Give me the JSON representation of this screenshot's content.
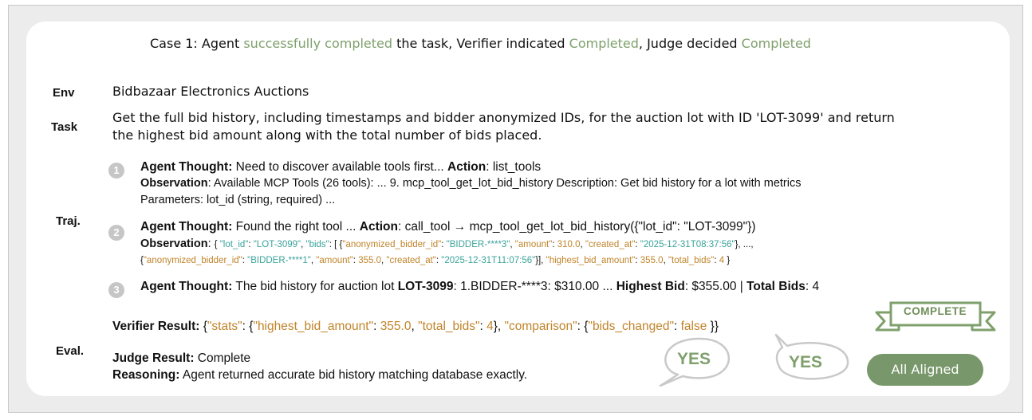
{
  "header": {
    "prefix": "Case 1: Agent ",
    "success_phrase": "successfully completed",
    "middle": " the task, Verifier indicated ",
    "verifier_word": "Completed",
    "sep": ", Judge decided ",
    "judge_word": "Completed"
  },
  "labels": {
    "env": "Env",
    "task": "Task",
    "traj": "Traj.",
    "eval": "Eval."
  },
  "env_text": "Bidbazaar Electronics Auctions",
  "task_line1": "Get the full bid history, including timestamps and bidder anonymized IDs, for the auction lot with ID 'LOT-3099' and return",
  "task_line2": "the highest bid amount along with the total number of bids placed.",
  "steps": [
    {
      "num": "1",
      "thought_label": "Agent Thought:",
      "thought": " Need to discover available tools first... ",
      "action_label": "Action",
      "action": ": list_tools",
      "obs_label": "Observation",
      "obs_line1": ": Available MCP Tools (26 tools): ... 9. mcp_tool_get_lot_bid_history Description: Get bid history for a lot with metrics",
      "obs_line2": "Parameters: lot_id (string, required) ..."
    },
    {
      "num": "2",
      "thought_label": "Agent Thought:",
      "thought": " Found the right tool ... ",
      "action_label": "Action",
      "action": ": call_tool → mcp_tool_get_lot_bid_history({\"lot_id\": \"LOT-3099\"})",
      "obs_label": "Observation",
      "obs_colon": ": ",
      "json1": {
        "p0": "{ ",
        "k0": "\"lot_id\"",
        "p1": ": ",
        "v0": "\"LOT-3099\"",
        "p2": ", ",
        "k1": "\"bids\"",
        "p3": ": [ {",
        "k2": "\"anonymized_bidder_id\"",
        "p4": ": ",
        "v1": "\"BIDDER-****3\"",
        "p5": ", ",
        "k3": "\"amount\"",
        "p6": ": ",
        "v2": "310.0",
        "p7": ", ",
        "k4": "\"created_at\"",
        "p8": ": ",
        "v3": "\"2025-12-31T08:37:56\"",
        "p9": "}, ...,"
      },
      "json2": {
        "p0": "{",
        "k0": "\"anonymized_bidder_id\"",
        "p1": ": ",
        "v0": "\"BIDDER-****1\"",
        "p2": ", ",
        "k1": "\"amount\"",
        "p3": ": ",
        "v1": "355.0",
        "p4": ", ",
        "k2": "\"created_at\"",
        "p5": ": ",
        "v2": "\"2025-12-31T11:07:56\"",
        "p6": "}], ",
        "k3": "\"highest_bid_amount\"",
        "p7": ": ",
        "v3": "355.0",
        "p8": ", ",
        "k4": "\"total_bids\"",
        "p9": ": ",
        "v4": "4",
        "p10": " }"
      }
    },
    {
      "num": "3",
      "thought_label": "Agent Thought:",
      "t1": " The bid history for auction lot ",
      "b1": "LOT-3099",
      "t2": ": 1.BIDDER-****3: $310.00 ... ",
      "b2": "Highest Bid",
      "t3": ": $355.00 | ",
      "b3": "Total Bids",
      "t4": ": 4"
    }
  ],
  "verifier": {
    "label": "Verifier Result:",
    "p0": " {",
    "k0": "\"stats\"",
    "p1": ": {",
    "k1": "\"highest_bid_amount\"",
    "p2": ": ",
    "v0": "355.0",
    "p3": ", ",
    "k2": "\"total_bids\"",
    "p4": ": ",
    "v1": "4",
    "p5": "}, ",
    "k3": "\"comparison\"",
    "p6": ": {",
    "k4": "\"bids_changed\"",
    "p7": ": ",
    "v2": "false",
    "p8": " }}"
  },
  "judge": {
    "label": "Judge Result:",
    "value": " Complete",
    "reason_label": "Reasoning:",
    "reason": " Agent returned accurate bid history matching database exactly."
  },
  "badges": {
    "ribbon": "COMPLETE",
    "yes1": "YES",
    "yes2": "YES",
    "aligned": "All Aligned"
  },
  "colors": {
    "green": "#7fa06c",
    "json_key": "#3aa39a",
    "json_value": "#c0842a",
    "pill": "#78976a",
    "step_circle": "#c6c6c6"
  }
}
